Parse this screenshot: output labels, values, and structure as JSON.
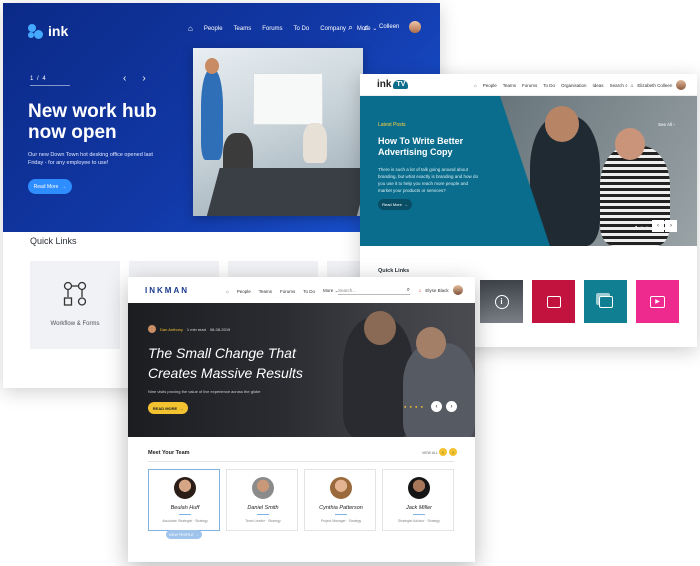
{
  "ink": {
    "brand": "ink",
    "nav": [
      "People",
      "Teams",
      "Forums",
      "To Do",
      "Company",
      "More"
    ],
    "more_caret": "⌄",
    "user": "Colleen",
    "slide_counter": "1 / 4",
    "hero_title": "New work hub now open",
    "hero_desc": "Our new Down Town hot desking office opened last Friday - for any employee to use!",
    "hero_button": "Read More",
    "quick_links_title": "Quick Links",
    "tile_label": "Workflow & Forms",
    "colors": {
      "hero_start": "#0b2a87",
      "hero_end": "#1a56d6",
      "button": "#2e8dff"
    }
  },
  "inktv": {
    "brand": "ink",
    "brand_tv": "TV",
    "nav": [
      "People",
      "Teams",
      "Forums",
      "To Do",
      "Organisation",
      "Ideas",
      "Search"
    ],
    "user": "Elizabeth Colleen",
    "latest": "Latest Posts",
    "hero_title": "How To Write Better Advertising Copy",
    "hero_desc": "There is such a lot of talk going around about branding, but what exactly is branding and how do you use it to help you reach more people and market your products or services?",
    "hero_button": "Read More",
    "see_all": "See All",
    "quick_links_title": "Quick Links",
    "tile_colors": [
      "#3e4248",
      "#c2123e",
      "#0f7f91",
      "#ee2a8f"
    ],
    "tile_icons": [
      "info-icon",
      "monitor-icon",
      "gallery-icon",
      "video-icon"
    ],
    "colors": {
      "teal": "#0b6d8d",
      "accent": "#ffd23f"
    }
  },
  "inkman": {
    "brand": "INKMAN",
    "nav": [
      "People",
      "Teams",
      "Forums",
      "To Do",
      "More"
    ],
    "search_placeholder": "Search...",
    "user": "Elyse Black",
    "author_tag": "Dan Anthony",
    "read_time": "1 min read",
    "date": "08-08-2019",
    "hero_title": "The Small Change That Creates Massive Results",
    "hero_desc": "Nine visits proving the value of live experience across the globe",
    "hero_button": "READ MORE",
    "meet_title": "Meet Your Team",
    "view_all": "VIEW ALL",
    "team": [
      {
        "name": "Beulah Huff",
        "role": "Associate Strategist · Strategy"
      },
      {
        "name": "Daniel Smith",
        "role": "Team Leader · Strategy"
      },
      {
        "name": "Cynthia Patterson",
        "role": "Project Manager · Strategy"
      },
      {
        "name": "Jack Miller",
        "role": "Strategist Advisor · Strategy"
      }
    ],
    "view_profile": "VIEW PROFILE",
    "colors": {
      "brand": "#1a3a8c",
      "accent": "#f2c230"
    }
  }
}
